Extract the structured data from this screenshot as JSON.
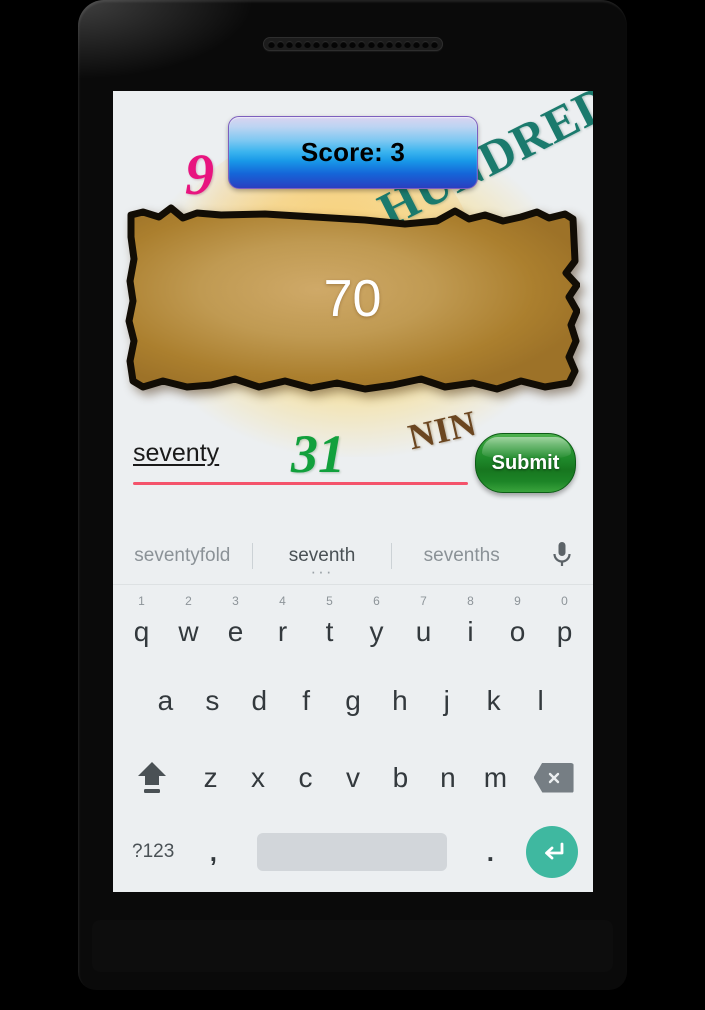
{
  "device": {
    "frame_color": "#0a0a0a",
    "speaker_hole_count": 19
  },
  "game": {
    "background_top_color": "#f4a83c",
    "background_bottom_color": "#fbe05c",
    "score": {
      "label": "Score: 3",
      "accent_top_color": "#d9d3f0",
      "accent_bottom_color": "#2a3fc0"
    },
    "prompt": {
      "number": "70",
      "parchment_color": "#b0832f"
    },
    "decorations": [
      {
        "name": "nine-digit",
        "text": "9",
        "color": "#e8147f"
      },
      {
        "name": "hundred-word",
        "text": "HUNDRED",
        "color": "#1b7a6d"
      },
      {
        "name": "nine-word",
        "text": "NIN",
        "color": "#6b4620"
      },
      {
        "name": "thirtyone-number",
        "text": "31",
        "color": "#11a03c"
      }
    ],
    "answer": {
      "value": "seventy",
      "underline_color": "#f4536b"
    },
    "submit": {
      "label": "Submit",
      "color": "#1f8a2b"
    }
  },
  "keyboard": {
    "background_color": "#eceff1",
    "suggestions": [
      {
        "text": "seventyfold",
        "selected": false
      },
      {
        "text": "seventh",
        "selected": true
      },
      {
        "text": "sevenths",
        "selected": false
      }
    ],
    "mic_icon": "microphone-icon",
    "row1": [
      {
        "letter": "q",
        "digit": "1"
      },
      {
        "letter": "w",
        "digit": "2"
      },
      {
        "letter": "e",
        "digit": "3"
      },
      {
        "letter": "r",
        "digit": "4"
      },
      {
        "letter": "t",
        "digit": "5"
      },
      {
        "letter": "y",
        "digit": "6"
      },
      {
        "letter": "u",
        "digit": "7"
      },
      {
        "letter": "i",
        "digit": "8"
      },
      {
        "letter": "o",
        "digit": "9"
      },
      {
        "letter": "p",
        "digit": "0"
      }
    ],
    "row2": [
      {
        "letter": "a"
      },
      {
        "letter": "s"
      },
      {
        "letter": "d"
      },
      {
        "letter": "f"
      },
      {
        "letter": "g"
      },
      {
        "letter": "h"
      },
      {
        "letter": "j"
      },
      {
        "letter": "k"
      },
      {
        "letter": "l"
      }
    ],
    "row3": [
      {
        "letter": "z"
      },
      {
        "letter": "x"
      },
      {
        "letter": "c"
      },
      {
        "letter": "v"
      },
      {
        "letter": "b"
      },
      {
        "letter": "n"
      },
      {
        "letter": "m"
      }
    ],
    "shift_icon": "shift-arrow-icon",
    "backspace_icon": "backspace-icon",
    "numeric_label": "?123",
    "comma_label": ",",
    "period_label": ".",
    "space_label": "",
    "enter_icon": "enter-arrow-icon",
    "enter_color": "#3fb8a0"
  }
}
